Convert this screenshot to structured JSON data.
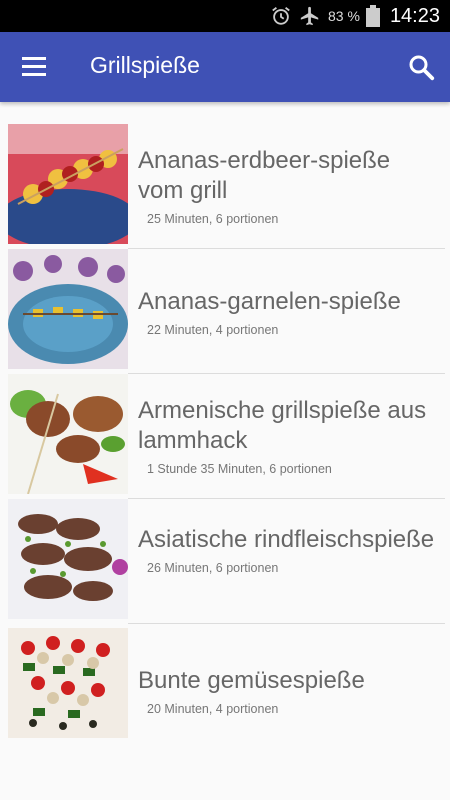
{
  "status_bar": {
    "battery": "83 %",
    "time": "14:23",
    "icons": [
      "alarm-icon",
      "airplane-mode-icon",
      "battery-icon"
    ]
  },
  "app_bar": {
    "title": "Grillspieße",
    "menu_icon": "hamburger-menu-icon",
    "search_icon": "search-icon",
    "color": "#3f51b5"
  },
  "recipes": [
    {
      "title": "Ananas-erdbeer-spieße vom grill",
      "subtitle": "25 Minuten, 6 portionen"
    },
    {
      "title": "Ananas-garnelen-spieße",
      "subtitle": "22 Minuten, 4 portionen"
    },
    {
      "title": "Armenische grillspieße aus lammhack",
      "subtitle": "1 Stunde 35 Minuten, 6 portionen"
    },
    {
      "title": "Asiatische rindfleischspieße",
      "subtitle": "26 Minuten, 6 portionen"
    },
    {
      "title": "Bunte gemüsespieße",
      "subtitle": "20 Minuten, 4 portionen"
    }
  ]
}
